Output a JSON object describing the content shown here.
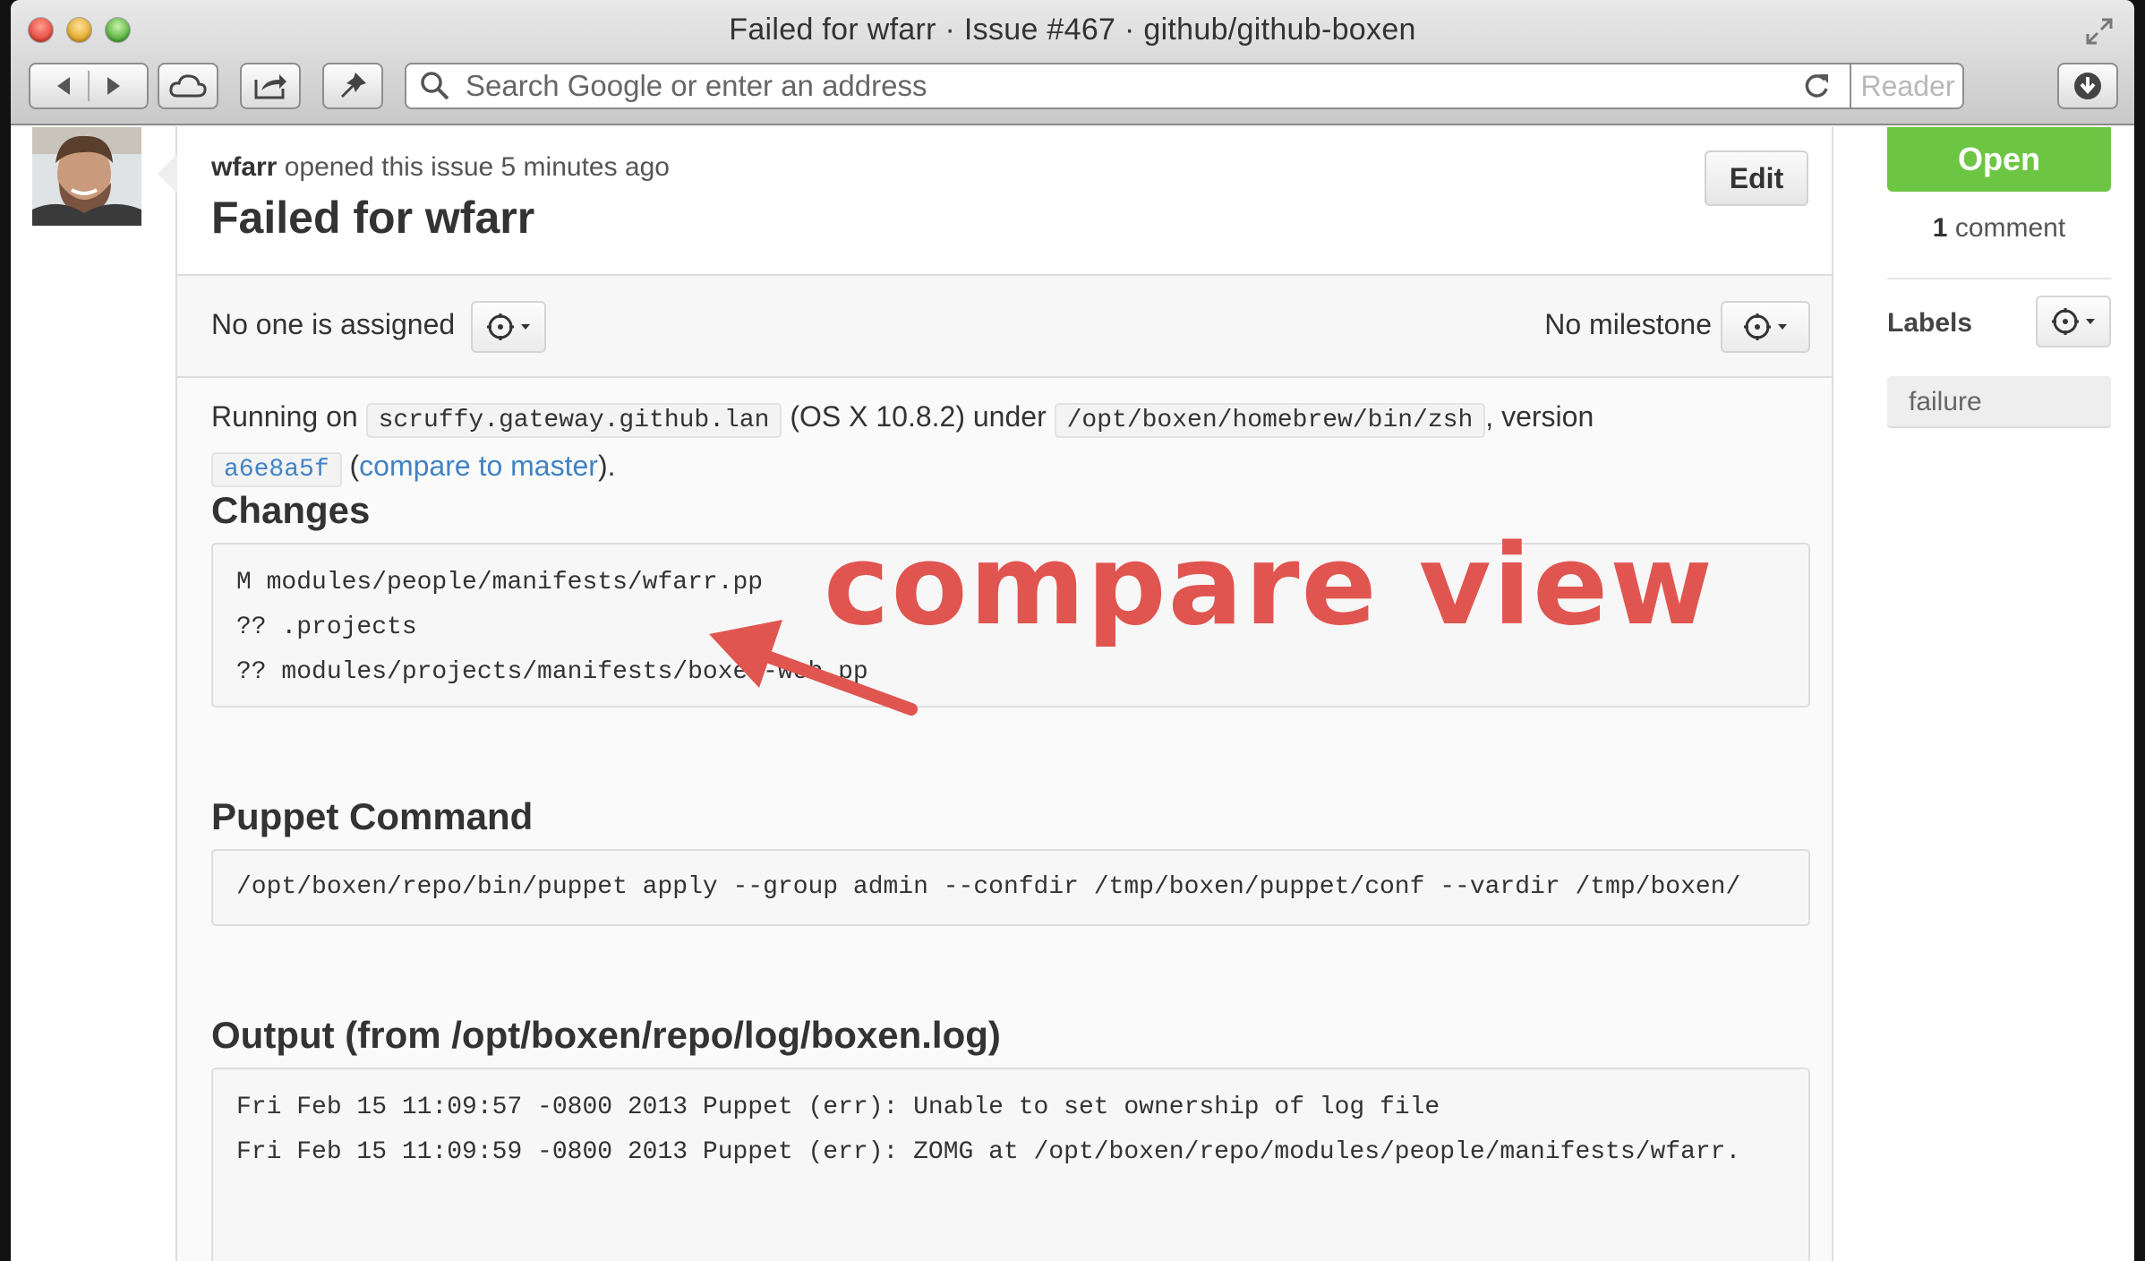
{
  "window": {
    "title": "Failed for wfarr · Issue #467 · github/github-boxen",
    "address_placeholder": "Search Google or enter an address",
    "reader_label": "Reader"
  },
  "issue": {
    "author": "wfarr",
    "opened_text": "opened this issue 5 minutes ago",
    "title": "Failed for wfarr",
    "edit_label": "Edit",
    "assignee_text": "No one is assigned",
    "milestone_text": "No milestone"
  },
  "body": {
    "running_on": "Running on",
    "host": "scruffy.gateway.github.lan",
    "os_under": "(OS X 10.8.2) under",
    "shell": "/opt/boxen/homebrew/bin/zsh",
    "version_text": ", version",
    "commit": "a6e8a5f",
    "compare_open": "(",
    "compare_link": "compare to master",
    "compare_close": ").",
    "changes_heading": "Changes",
    "changes": [
      "M modules/people/manifests/wfarr.pp",
      "?? .projects",
      "?? modules/projects/manifests/boxen-web.pp"
    ],
    "puppet_heading": "Puppet Command",
    "puppet_command": "/opt/boxen/repo/bin/puppet apply --group admin --confdir /tmp/boxen/puppet/conf --vardir /tmp/boxen/",
    "output_heading": "Output (from /opt/boxen/repo/log/boxen.log)",
    "output_lines": [
      "Fri Feb 15 11:09:57 -0800 2013 Puppet (err): Unable to set ownership of log file",
      "Fri Feb 15 11:09:59 -0800 2013 Puppet (err): ZOMG at /opt/boxen/repo/modules/people/manifests/wfarr."
    ]
  },
  "sidebar": {
    "state": "Open",
    "comment_count": "1",
    "comment_word": "comment",
    "labels_title": "Labels",
    "labels": [
      "failure"
    ]
  },
  "annotation": {
    "text": "compare view",
    "color": "#e05550"
  },
  "colors": {
    "open_green": "#6cc644",
    "link_blue": "#4183c4"
  }
}
